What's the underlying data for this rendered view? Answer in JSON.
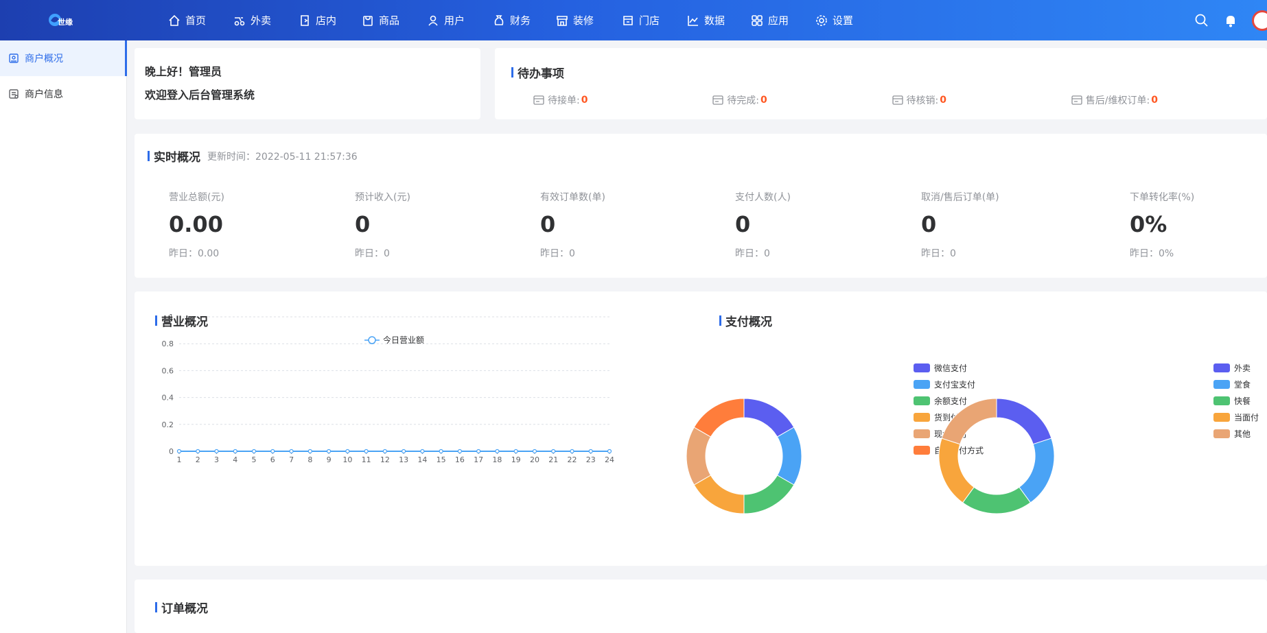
{
  "app": {
    "logo_text": "世缘"
  },
  "nav": {
    "items": [
      {
        "label": "首页",
        "icon": "home-icon"
      },
      {
        "label": "外卖",
        "icon": "delivery-icon"
      },
      {
        "label": "店内",
        "icon": "dine-in-icon"
      },
      {
        "label": "商品",
        "icon": "product-icon"
      },
      {
        "label": "用户",
        "icon": "user-icon"
      },
      {
        "label": "财务",
        "icon": "finance-icon"
      },
      {
        "label": "装修",
        "icon": "decorate-icon"
      },
      {
        "label": "门店",
        "icon": "store-icon"
      },
      {
        "label": "数据",
        "icon": "data-icon"
      },
      {
        "label": "应用",
        "icon": "apps-icon"
      },
      {
        "label": "设置",
        "icon": "settings-icon"
      }
    ]
  },
  "sidebar": {
    "items": [
      {
        "label": "商户概况",
        "active": true
      },
      {
        "label": "商户信息",
        "active": false
      }
    ]
  },
  "welcome": {
    "line1": "晚上好！管理员",
    "line2": "欢迎登入后台管理系统"
  },
  "todo": {
    "title": "待办事项",
    "items": [
      {
        "label": "待接单:",
        "value": "0"
      },
      {
        "label": "待完成:",
        "value": "0"
      },
      {
        "label": "待核销:",
        "value": "0"
      },
      {
        "label": "售后/维权订单:",
        "value": "0"
      }
    ]
  },
  "realtime": {
    "title": "实时概况",
    "update_time": "更新时间：2022-05-11 21:57:36",
    "stats": [
      {
        "label": "营业总额(元)",
        "value": "0.00",
        "yesterday": "昨日：0.00"
      },
      {
        "label": "预计收入(元)",
        "value": "0",
        "yesterday": "昨日：0"
      },
      {
        "label": "有效订单数(单)",
        "value": "0",
        "yesterday": "昨日：0"
      },
      {
        "label": "支付人数(人)",
        "value": "0",
        "yesterday": "昨日：0"
      },
      {
        "label": "取消/售后订单(单)",
        "value": "0",
        "yesterday": "昨日：0"
      },
      {
        "label": "下单转化率(%)",
        "value": "0%",
        "yesterday": "昨日：0%"
      }
    ]
  },
  "business_overview": {
    "title": "营业概况"
  },
  "payment_overview": {
    "title": "支付概况"
  },
  "order_overview": {
    "title": "订单概况"
  },
  "colors": {
    "accent": "#2d6ce9",
    "highlight": "#ff5722"
  },
  "chart_data": [
    {
      "type": "line",
      "title": "",
      "xlabel": "",
      "ylabel": "",
      "x": [
        1,
        2,
        3,
        4,
        5,
        6,
        7,
        8,
        9,
        10,
        11,
        12,
        13,
        14,
        15,
        16,
        17,
        18,
        19,
        20,
        21,
        22,
        23,
        24
      ],
      "yticks": [
        0,
        0.2,
        0.4,
        0.6,
        0.8,
        1
      ],
      "ylim": [
        0,
        1
      ],
      "grid": true,
      "legend": "top-center",
      "series": [
        {
          "name": "今日营业额",
          "color": "#4aa3f5",
          "values": [
            0,
            0,
            0,
            0,
            0,
            0,
            0,
            0,
            0,
            0,
            0,
            0,
            0,
            0,
            0,
            0,
            0,
            0,
            0,
            0,
            0,
            0,
            0,
            0
          ]
        }
      ]
    },
    {
      "type": "pie",
      "legend": "right",
      "slices": [
        {
          "name": "微信支付",
          "value": 1,
          "color": "#5b5ef0"
        },
        {
          "name": "支付宝支付",
          "value": 1,
          "color": "#4aa3f5"
        },
        {
          "name": "余额支付",
          "value": 1,
          "color": "#4ec372"
        },
        {
          "name": "货到付款",
          "value": 1,
          "color": "#f8a53c"
        },
        {
          "name": "现金支付",
          "value": 1,
          "color": "#e9a574"
        },
        {
          "name": "自有支付方式",
          "value": 1,
          "color": "#ff7d3b"
        }
      ]
    },
    {
      "type": "pie",
      "legend": "right",
      "slices": [
        {
          "name": "外卖",
          "value": 1,
          "color": "#5b5ef0"
        },
        {
          "name": "堂食",
          "value": 1,
          "color": "#4aa3f5"
        },
        {
          "name": "快餐",
          "value": 1,
          "color": "#4ec372"
        },
        {
          "name": "当面付",
          "value": 1,
          "color": "#f8a53c"
        },
        {
          "name": "其他",
          "value": 1,
          "color": "#e9a574"
        }
      ]
    }
  ]
}
